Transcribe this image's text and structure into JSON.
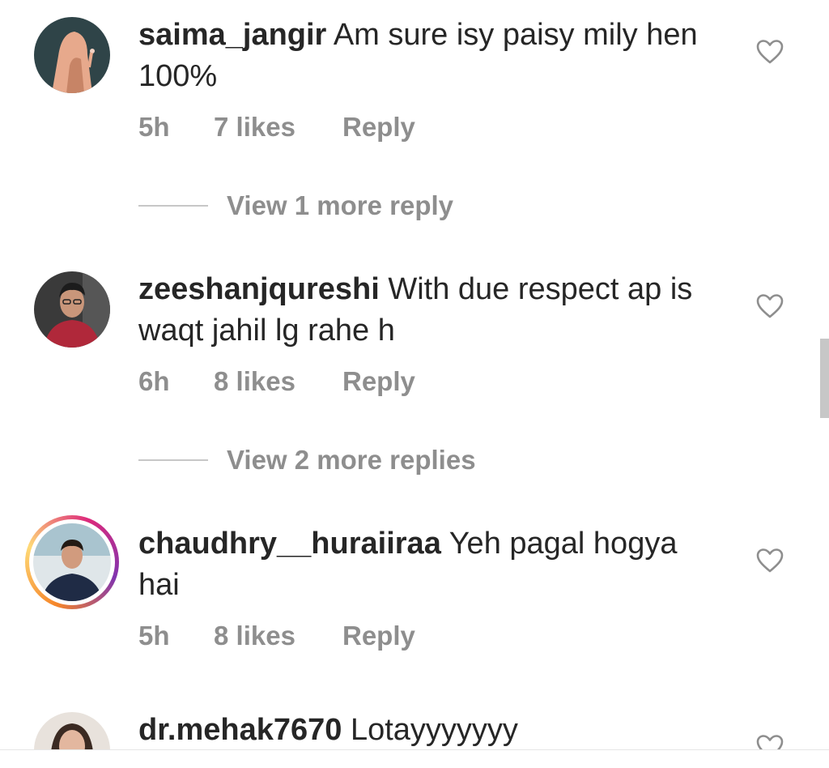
{
  "comments": [
    {
      "username": "saima_jangir",
      "text": "Am sure isy paisy mily hen 100%",
      "time": "5h",
      "likes": "7 likes",
      "reply": "Reply",
      "view_replies": "View 1 more reply"
    },
    {
      "username": "zeeshanjqureshi",
      "text": "With due respect ap is waqt jahil lg rahe h",
      "time": "6h",
      "likes": "8 likes",
      "reply": "Reply",
      "view_replies": "View 2 more replies"
    },
    {
      "username": "chaudhry__huraiiraa",
      "text": "Yeh pagal hogya hai",
      "time": "5h",
      "likes": "8 likes",
      "reply": "Reply"
    },
    {
      "username": "dr.mehak7670",
      "text": "Lotayyyyyyy"
    }
  ],
  "icons": {
    "like": "heart-outline-icon"
  },
  "colors": {
    "text": "#262626",
    "secondary": "#8e8e8e",
    "story_ring": [
      "#f58529",
      "#dd2a7b",
      "#8134af"
    ]
  }
}
